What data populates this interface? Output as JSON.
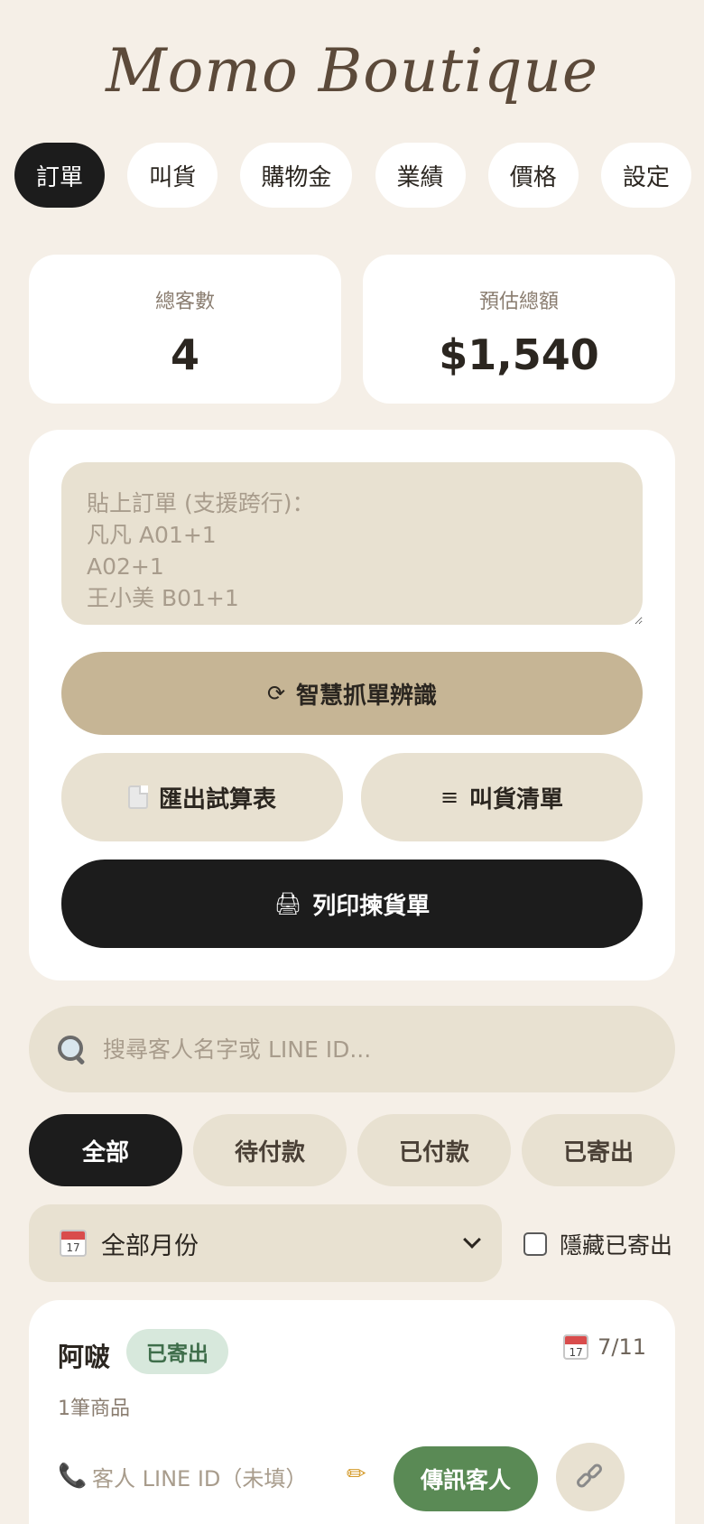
{
  "app": {
    "brand": "Momo Boutique"
  },
  "nav": {
    "tabs": [
      {
        "label": "訂單",
        "active": true
      },
      {
        "label": "叫貨",
        "active": false
      },
      {
        "label": "購物金",
        "active": false
      },
      {
        "label": "業績",
        "active": false
      },
      {
        "label": "價格",
        "active": false
      },
      {
        "label": "設定",
        "active": false
      }
    ]
  },
  "stats": {
    "customers_label": "總客數",
    "customers_value": "4",
    "total_label": "預估總額",
    "total_value": "$1,540"
  },
  "order_input": {
    "placeholder": "貼上訂單 (支援跨行)：\n凡凡 A01+1\nA02+1\n王小美 B01+1",
    "parse_icon": "⟳",
    "parse_label": "智慧抓單辨識",
    "export_label": "匯出試算表",
    "list_icon": "≡",
    "list_label": "叫貨清單",
    "print_icon": "🖨",
    "print_label": "列印揀貨單"
  },
  "search": {
    "placeholder": "搜尋客人名字或 LINE ID..."
  },
  "filters": [
    {
      "label": "全部",
      "active": true
    },
    {
      "label": "待付款",
      "active": false
    },
    {
      "label": "已付款",
      "active": false
    },
    {
      "label": "已寄出",
      "active": false
    }
  ],
  "month_filter": {
    "calendar_day": "17",
    "selected": "全部月份"
  },
  "hide_shipped": {
    "label": "隱藏已寄出",
    "checked": false
  },
  "customers": [
    {
      "name": "阿啵",
      "status": "已寄出",
      "date": "7/11",
      "item_count": "1筆商品",
      "line_placeholder": "客人 LINE ID（未填）",
      "message_label": "傳訊客人"
    }
  ],
  "colors": {
    "background": "#f5efe7",
    "accent_dark": "#1c1c1c",
    "parse_button": "#c6b595",
    "chip": "#e8e1d1",
    "message_green": "#5a8a55",
    "shipped_badge": "#d7e8dc"
  }
}
